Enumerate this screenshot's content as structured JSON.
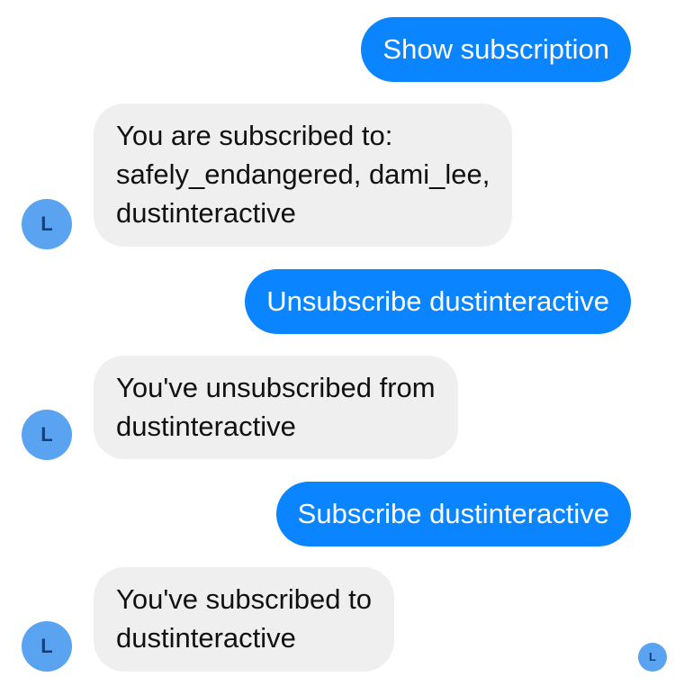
{
  "conversation": {
    "messages": [
      {
        "from": "user",
        "text": "Show subscription"
      },
      {
        "from": "bot",
        "text": "You are subscribed to:\nsafely_endangered, dami_lee,\ndustinteractive",
        "avatar": "L"
      },
      {
        "from": "user",
        "text": "Unsubscribe dustinteractive"
      },
      {
        "from": "bot",
        "text": "You've unsubscribed from\ndustinteractive",
        "avatar": "L"
      },
      {
        "from": "user",
        "text": "Subscribe dustinteractive"
      },
      {
        "from": "bot",
        "text": "You've subscribed to\ndustinteractive",
        "avatar": "L"
      }
    ],
    "read_receipt_avatar": "L"
  },
  "colors": {
    "outgoing_bubble": "#0a84ff",
    "incoming_bubble": "#efefef",
    "avatar": "#5aa3f0",
    "avatar_text": "#1a3d7a"
  }
}
